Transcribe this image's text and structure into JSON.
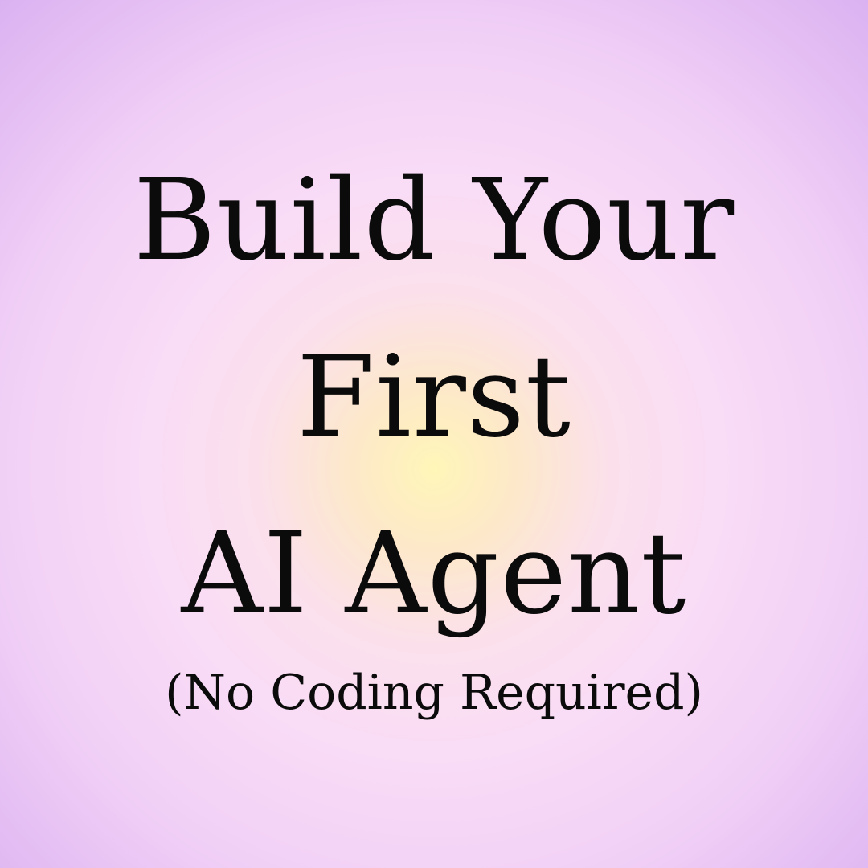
{
  "title": {
    "line1": "Build Your",
    "line2": "First",
    "line3": "AI Agent"
  },
  "subtitle": "(No Coding Required)",
  "colors": {
    "text": "#0b0b0b",
    "background_center": "#fff6b8",
    "background_mid": "#f9dcf6",
    "background_edge": "#dbb2f1"
  }
}
